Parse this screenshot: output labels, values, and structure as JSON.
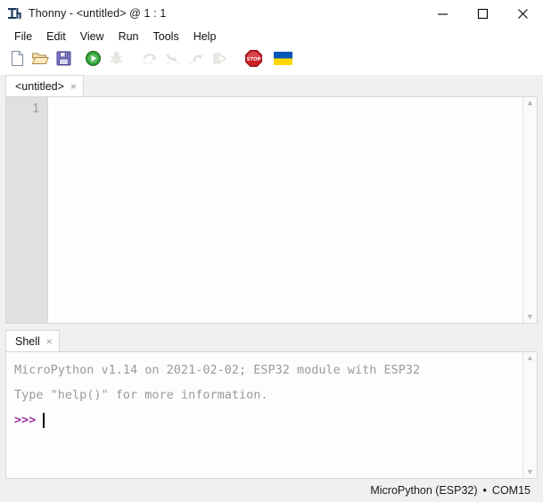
{
  "window": {
    "title": "Thonny  -  <untitled>  @  1 : 1",
    "app_icon": "thonny-logo-icon",
    "controls": {
      "minimize": "minimize-icon",
      "maximize": "maximize-icon",
      "close": "close-icon"
    }
  },
  "menubar": {
    "items": [
      {
        "label": "File"
      },
      {
        "label": "Edit"
      },
      {
        "label": "View"
      },
      {
        "label": "Run"
      },
      {
        "label": "Tools"
      },
      {
        "label": "Help"
      }
    ]
  },
  "toolbar": {
    "buttons": [
      {
        "name": "new-file-button",
        "icon": "new-file-icon",
        "enabled": true
      },
      {
        "name": "open-file-button",
        "icon": "open-folder-icon",
        "enabled": true
      },
      {
        "name": "save-file-button",
        "icon": "save-floppy-icon",
        "enabled": true
      },
      {
        "name": "run-button",
        "icon": "run-play-icon",
        "enabled": true
      },
      {
        "name": "debug-button",
        "icon": "debug-bug-icon",
        "enabled": false
      },
      {
        "name": "step-over-button",
        "icon": "step-over-icon",
        "enabled": false
      },
      {
        "name": "step-into-button",
        "icon": "step-into-icon",
        "enabled": false
      },
      {
        "name": "step-out-button",
        "icon": "step-out-icon",
        "enabled": false
      },
      {
        "name": "resume-button",
        "icon": "resume-icon",
        "enabled": false
      },
      {
        "name": "stop-button",
        "icon": "stop-sign-icon",
        "enabled": true
      },
      {
        "name": "ukraine-flag",
        "icon": "ukraine-flag-icon",
        "enabled": true
      }
    ]
  },
  "editor": {
    "tab": {
      "label": "<untitled>",
      "close": "×"
    },
    "line_numbers": [
      "1"
    ],
    "content": "",
    "scrollbar": {
      "up": "▲",
      "down": "▼"
    }
  },
  "shell": {
    "tab": {
      "label": "Shell",
      "close": "×"
    },
    "lines": [
      "MicroPython v1.14 on 2021-02-02; ESP32 module with ESP32",
      "Type \"help()\" for more information."
    ],
    "prompt": ">>>",
    "input_value": "",
    "scrollbar": {
      "up": "▲",
      "down": "▼"
    }
  },
  "statusbar": {
    "interpreter": "MicroPython (ESP32)",
    "separator": "•",
    "port": "COM15"
  },
  "colors": {
    "accent_green": "#2f9e34",
    "accent_stop_red": "#cc2026",
    "prompt_purple": "#9b2d9b",
    "shell_text_gray": "#9a9a9a",
    "gutter_bg": "#e0e0e0",
    "panel_bg": "#f0f0f0",
    "flag_blue": "#0057b7",
    "flag_yellow": "#ffd700"
  }
}
